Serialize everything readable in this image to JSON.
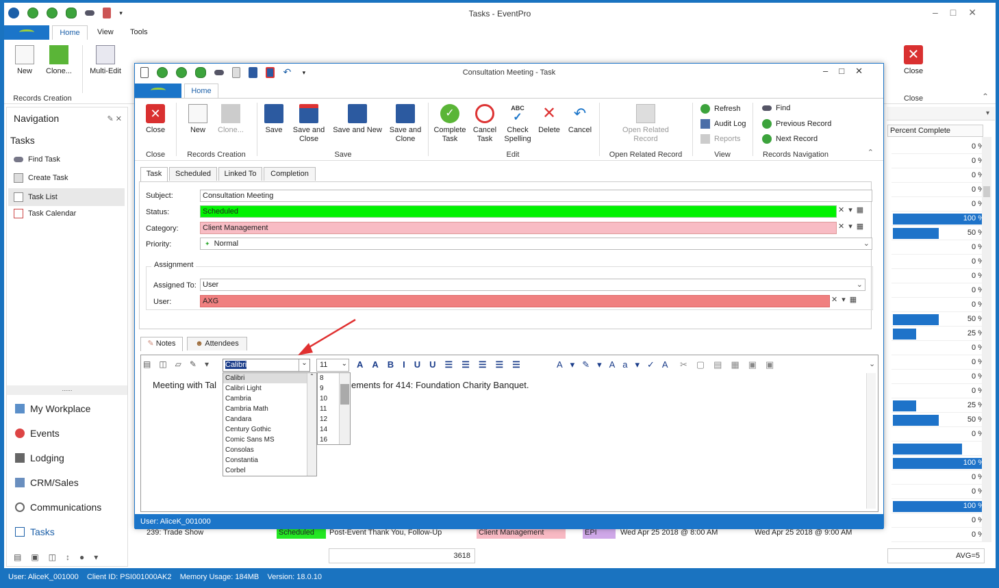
{
  "main_title": "Tasks - EventPro",
  "main_tabs": [
    "Home",
    "View",
    "Tools"
  ],
  "main_ribbon": {
    "new": "New",
    "clone": "Clone...",
    "multi_edit": "Multi-Edit",
    "records_creation": "Records Creation",
    "close": "Close",
    "close_group": "Close"
  },
  "navigation": {
    "title": "Navigation",
    "section": "Tasks",
    "items": [
      "Find Task",
      "Create Task",
      "Task List",
      "Task Calendar"
    ],
    "big_items": [
      "My Workplace",
      "Events",
      "Lodging",
      "CRM/Sales",
      "Communications",
      "Tasks"
    ]
  },
  "grid": {
    "header": "Percent Complete",
    "rows": [
      {
        "v": "0 %",
        "f": 0
      },
      {
        "v": "0 %",
        "f": 0
      },
      {
        "v": "0 %",
        "f": 0
      },
      {
        "v": "0 %",
        "f": 0
      },
      {
        "v": "0 %",
        "f": 0
      },
      {
        "v": "100 %",
        "f": 1
      },
      {
        "v": "50 %",
        "f": 0.5
      },
      {
        "v": "0 %",
        "f": 0
      },
      {
        "v": "0 %",
        "f": 0
      },
      {
        "v": "0 %",
        "f": 0
      },
      {
        "v": "0 %",
        "f": 0
      },
      {
        "v": "0 %",
        "f": 0
      },
      {
        "v": "50 %",
        "f": 0.5
      },
      {
        "v": "25 %",
        "f": 0.25
      },
      {
        "v": "0 %",
        "f": 0
      },
      {
        "v": "0 %",
        "f": 0
      },
      {
        "v": "0 %",
        "f": 0
      },
      {
        "v": "0 %",
        "f": 0
      },
      {
        "v": "25 %",
        "f": 0.25
      },
      {
        "v": "50 %",
        "f": 0.5
      },
      {
        "v": "0 %",
        "f": 0
      },
      {
        "v": "75 %",
        "f": 0.75
      },
      {
        "v": "100 %",
        "f": 1
      },
      {
        "v": "0 %",
        "f": 0
      },
      {
        "v": "0 %",
        "f": 0
      },
      {
        "v": "100 %",
        "f": 1
      },
      {
        "v": "0 %",
        "f": 0
      },
      {
        "v": "0 %",
        "f": 0
      }
    ],
    "footer_count": "3618",
    "footer_avg": "AVG=5",
    "bottom_row": {
      "name": "239: Trade Show",
      "status": "Scheduled",
      "subject": "Post-Event Thank You, Follow-Up",
      "category": "Client Management",
      "user": "EPI",
      "start": "Wed Apr 25 2018 @ 8:00 AM",
      "end": "Wed Apr 25 2018 @ 9:00 AM"
    }
  },
  "dialog": {
    "title": "Consultation Meeting - Task",
    "tab": "Home",
    "buttons": {
      "close": "Close",
      "new": "New",
      "clone": "Clone...",
      "save": "Save",
      "save_close": "Save and Close",
      "save_new": "Save and New",
      "save_clone": "Save and Clone",
      "complete": "Complete Task",
      "cancel_task": "Cancel Task",
      "check_spelling": "Check Spelling",
      "delete": "Delete",
      "cancel": "Cancel",
      "open_related": "Open Related Record",
      "refresh": "Refresh",
      "audit_log": "Audit Log",
      "reports": "Reports",
      "find": "Find",
      "previous": "Previous Record",
      "next": "Next Record"
    },
    "groups": {
      "close": "Close",
      "records_creation": "Records Creation",
      "save": "Save",
      "edit": "Edit",
      "open_related": "Open Related Record",
      "view": "View",
      "navigation": "Records Navigation"
    },
    "form_tabs": [
      "Task",
      "Scheduled",
      "Linked To",
      "Completion"
    ],
    "labels": {
      "subject": "Subject:",
      "status": "Status:",
      "category": "Category:",
      "priority": "Priority:",
      "assignment": "Assignment",
      "assigned_to": "Assigned To:",
      "user": "User:"
    },
    "values": {
      "subject": "Consultation Meeting",
      "status": "Scheduled",
      "category": "Client Management",
      "priority": "Normal",
      "assigned_to": "User",
      "user": "AXG"
    },
    "note_tabs": [
      "Notes",
      "Attendees"
    ],
    "font": "Calibri",
    "size": "11",
    "fonts": [
      "Calibri",
      "Calibri Light",
      "Cambria",
      "Cambria Math",
      "Candara",
      "Century Gothic",
      "Comic Sans MS",
      "Consolas",
      "Constantia",
      "Corbel"
    ],
    "sizes": [
      "8",
      "9",
      "10",
      "11",
      "12",
      "14",
      "16"
    ],
    "note_left": "Meeting with Tal",
    "note_right": "ements for 414: Foundation Charity Banquet.",
    "status_user": "User: AliceK_001000"
  },
  "statusbar": "User: AliceK_001000    Client ID: PSI001000AK2    Memory Usage: 184MB    Version: 18.0.10"
}
